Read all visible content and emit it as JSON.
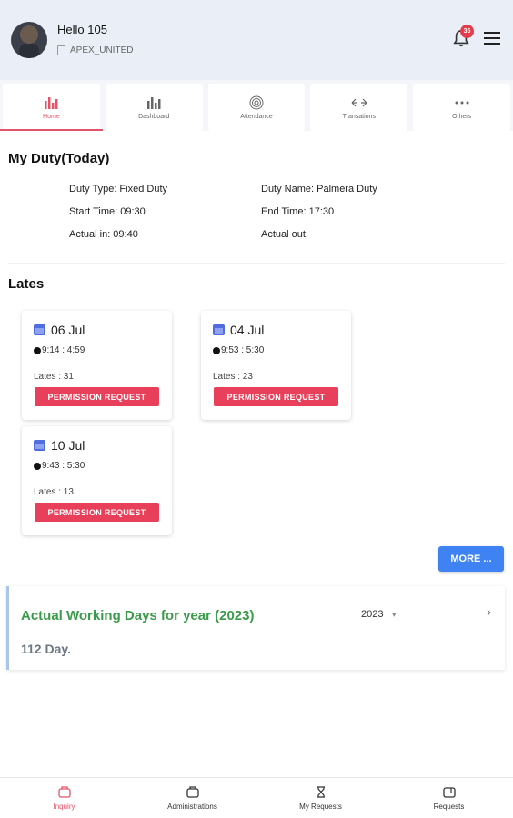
{
  "header": {
    "greeting": "Hello 105",
    "organization": "APEX_UNITED",
    "notification_count": "35"
  },
  "tabs": [
    {
      "label": "Home",
      "icon": "bar-chart-icon",
      "active": true
    },
    {
      "label": "Dashboard",
      "icon": "bar-chart-icon"
    },
    {
      "label": "Attendance",
      "icon": "fingerprint-icon"
    },
    {
      "label": "Transations",
      "icon": "transfer-arrows-icon"
    },
    {
      "label": "Others",
      "icon": "more-dots-icon"
    }
  ],
  "duty": {
    "title": "My Duty(Today)",
    "duty_type": "Duty Type: Fixed Duty",
    "duty_name": "Duty Name: Palmera Duty",
    "start_time": "Start Time: 09:30",
    "end_time": "End Time: 17:30",
    "actual_in": "Actual in: 09:40",
    "actual_out": "Actual out:"
  },
  "lates": {
    "title": "Lates",
    "cards": [
      {
        "date": "06 Jul",
        "time": "9:14 : 4:59",
        "lates": "Lates : 31",
        "button": "PERMISSION REQUEST"
      },
      {
        "date": "04 Jul",
        "time": "9:53 : 5:30",
        "lates": "Lates : 23",
        "button": "PERMISSION REQUEST"
      },
      {
        "date": "10 Jul",
        "time": "9:43 : 5:30",
        "lates": "Lates : 13",
        "button": "PERMISSION REQUEST"
      }
    ],
    "more_button": "MORE ..."
  },
  "working_days": {
    "title": "Actual Working Days for year (2023)",
    "year_select": "2023",
    "value": "112 Day."
  },
  "bottom_nav": [
    {
      "label": "Inquiry",
      "active": true
    },
    {
      "label": "Administrations"
    },
    {
      "label": "My Requests"
    },
    {
      "label": "Requests"
    }
  ],
  "colors": {
    "accent": "#e0556a",
    "permission_button": "#e8405a",
    "more_button": "#3f82f3",
    "working_days_title": "#3a9b4a",
    "header_bg": "#e9eef7"
  }
}
